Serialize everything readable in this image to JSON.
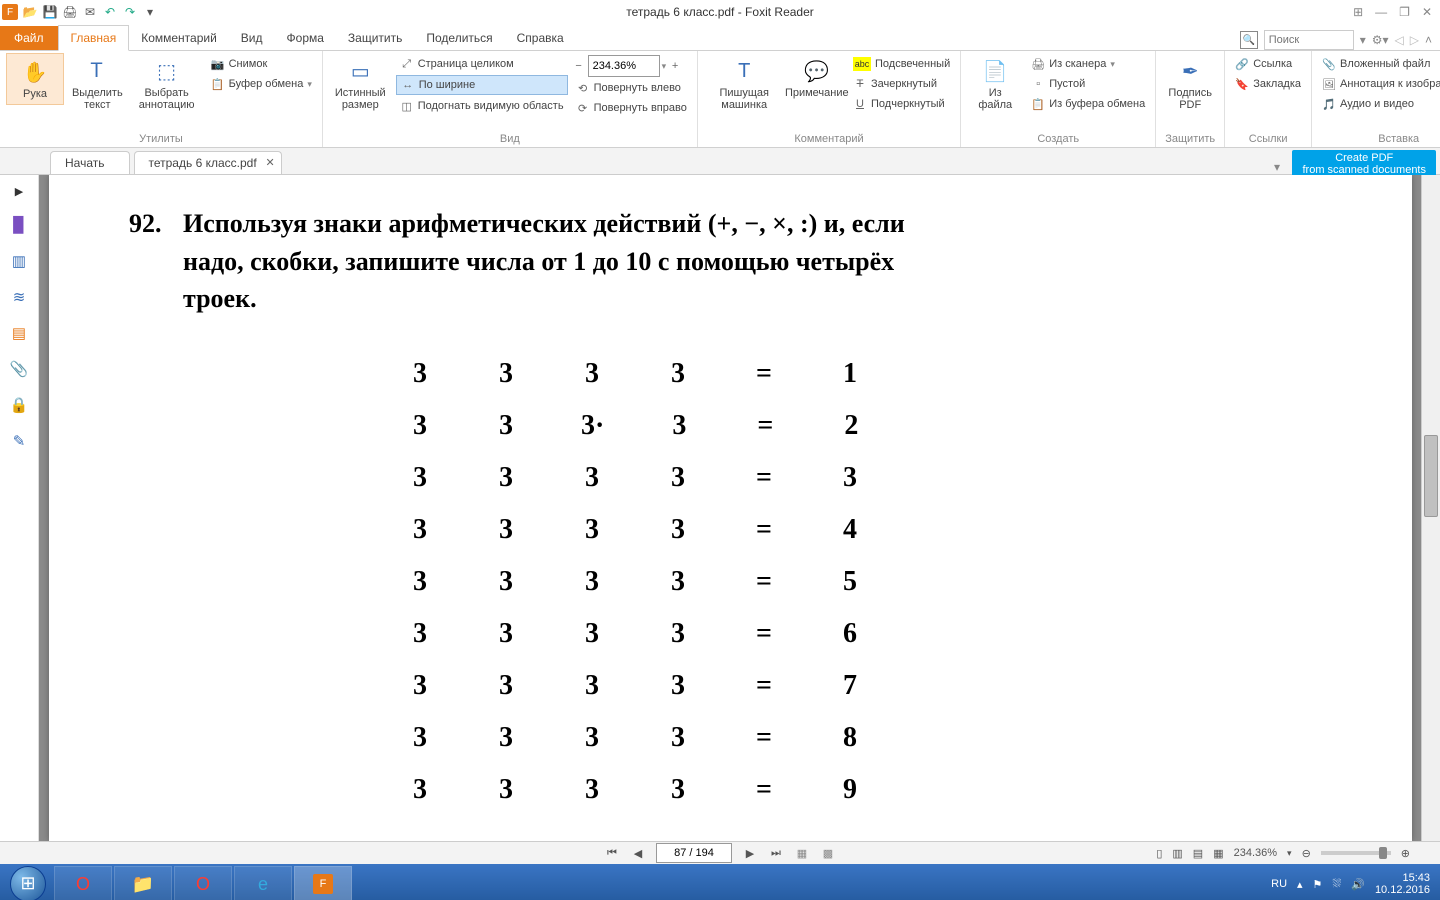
{
  "titlebar": {
    "document_title": "тетрадь 6 класс.pdf - Foxit Reader"
  },
  "qat": [
    "open",
    "save",
    "print",
    "email",
    "undo",
    "redo"
  ],
  "ribbon": {
    "file_tab": "Файл",
    "tabs": [
      "Главная",
      "Комментарий",
      "Вид",
      "Форма",
      "Защитить",
      "Поделиться",
      "Справка"
    ],
    "active_tab": 0,
    "search_placeholder": "Поиск",
    "groups": {
      "tools": {
        "hand": "Рука",
        "select_text": "Выделить текст",
        "select_annot": "Выбрать аннотацию",
        "snapshot": "Снимок",
        "clipboard": "Буфер обмена",
        "label": "Утилиты"
      },
      "view": {
        "actual_size": "Истинный размер",
        "fit_page": "Страница целиком",
        "fit_width": "По ширине",
        "fit_visible": "Подогнать видимую область",
        "zoom_value": "234.36%",
        "rotate_left": "Повернуть влево",
        "rotate_right": "Повернуть вправо",
        "label": "Вид"
      },
      "comment": {
        "typewriter": "Пишущая машинка",
        "note": "Примечание",
        "highlight": "Подсвеченный",
        "strike": "Зачеркнутый",
        "underline": "Подчеркнутый",
        "label": "Комментарий"
      },
      "create": {
        "from_file": "Из файла",
        "from_scanner": "Из сканера",
        "blank": "Пустой",
        "from_clipboard": "Из буфера обмена",
        "label": "Создать"
      },
      "protect": {
        "sign": "Подпись PDF",
        "label": "Защитить"
      },
      "links": {
        "link": "Ссылка",
        "bookmark": "Закладка",
        "label": "Ссылки"
      },
      "insert": {
        "file_attach": "Вложенный файл",
        "image_annot": "Аннотация к изображению",
        "audio_video": "Аудио и видео",
        "label": "Вставка"
      }
    }
  },
  "doctabs": {
    "start": "Начать",
    "current": "тетрадь 6 класс.pdf",
    "ad_line1": "Create PDF",
    "ad_line2": "from scanned documents"
  },
  "document": {
    "problem_number": "92.",
    "problem_text_l1": "Используя знаки арифметических действий (+, −, ×, :) и, если",
    "problem_text_l2": "надо, скобки, запишите числа от 1 до 10 с помощью четырёх",
    "problem_text_l3": "троек.",
    "rows": [
      {
        "a": "3",
        "b": "3",
        "c": "3",
        "d": "3",
        "eq": "=",
        "r": "1"
      },
      {
        "a": "3",
        "b": "3",
        "c": "3·",
        "d": "3",
        "eq": "=",
        "r": "2"
      },
      {
        "a": "3",
        "b": "3",
        "c": "3",
        "d": "3",
        "eq": "=",
        "r": "3"
      },
      {
        "a": "3",
        "b": "3",
        "c": "3",
        "d": "3",
        "eq": "=",
        "r": "4"
      },
      {
        "a": "3",
        "b": "3",
        "c": "3",
        "d": "3",
        "eq": "=",
        "r": "5"
      },
      {
        "a": "3",
        "b": "3",
        "c": "3",
        "d": "3",
        "eq": "=",
        "r": "6"
      },
      {
        "a": "3",
        "b": "3",
        "c": "3",
        "d": "3",
        "eq": "=",
        "r": "7"
      },
      {
        "a": "3",
        "b": "3",
        "c": "3",
        "d": "3",
        "eq": "=",
        "r": "8"
      },
      {
        "a": "3",
        "b": "3",
        "c": "3",
        "d": "3",
        "eq": "=",
        "r": "9"
      }
    ]
  },
  "pagenav": {
    "value": "87 / 194",
    "zoom": "234.36%"
  },
  "taskbar": {
    "lang": "RU",
    "time": "15:43",
    "date": "10.12.2016"
  }
}
